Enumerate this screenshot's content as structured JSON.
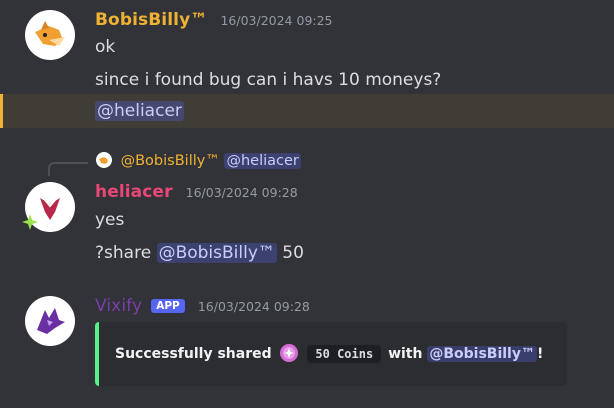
{
  "messages": [
    {
      "author": "BobisBilly™",
      "author_color": "#f0b232",
      "timestamp": "16/03/2024 09:25",
      "lines": [
        "ok",
        "since i found bug can i havs 10 moneys?"
      ],
      "mention_line": "@heliacer"
    },
    {
      "reply_to": {
        "author": "@BobisBilly™",
        "mention": "@heliacer"
      },
      "author": "heliacer",
      "author_color": "#e94775",
      "timestamp": "16/03/2024 09:28",
      "line1": "yes",
      "line2_prefix": "?share",
      "line2_mention": "@BobisBilly™",
      "line2_suffix": "50"
    },
    {
      "author": "Vixify",
      "author_color": "#7b3fa8",
      "badge": "APP",
      "timestamp": "16/03/2024 09:28",
      "embed": {
        "text_before": "Successfully shared",
        "coin_icon": "coin-icon",
        "amount": "50 Coins",
        "text_with": "with",
        "mention": "@BobisBilly™",
        "text_after": "!",
        "accent": "#57f287"
      }
    }
  ]
}
